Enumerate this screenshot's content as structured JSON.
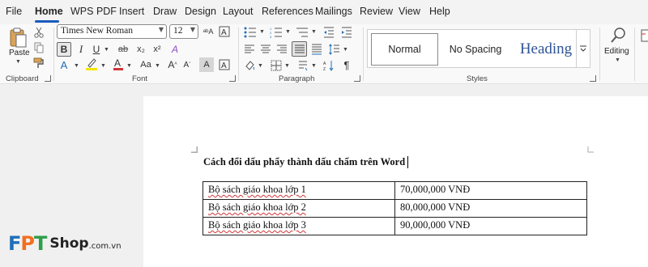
{
  "menu": {
    "tabs": [
      "File",
      "Home",
      "WPS PDF",
      "Insert",
      "Draw",
      "Design",
      "Layout",
      "References",
      "Mailings",
      "Review",
      "View",
      "Help"
    ],
    "active": "Home"
  },
  "ribbon": {
    "clipboard": {
      "paste_label": "Paste",
      "group_label": "Clipboard"
    },
    "font": {
      "font_name": "Times New Roman",
      "font_size": "12",
      "group_label": "Font",
      "accent_colors": {
        "highlight": "#f5e400",
        "font_color": "#d13438"
      }
    },
    "paragraph": {
      "group_label": "Paragraph"
    },
    "styles": {
      "items": [
        "Normal",
        "No Spacing",
        "Heading"
      ],
      "group_label": "Styles"
    },
    "editing": {
      "label": "Editing"
    }
  },
  "document": {
    "heading": "Cách đổi dấu phẩy thành dấu chấm trên Word",
    "table": {
      "rows": [
        [
          "Bộ sách giáo khoa lớp 1",
          "70,000,000 VNĐ"
        ],
        [
          "Bộ sách giáo khoa lớp 2",
          "80,000,000 VNĐ"
        ],
        [
          "Bộ sách giáo khoa lớp 3",
          "90,000,000 VNĐ"
        ]
      ]
    }
  },
  "watermark": {
    "brand": "FPT",
    "shop": "Shop",
    "domain": ".com.vn",
    "colors": {
      "f": "#1e6fb8",
      "p": "#f26f21",
      "t": "#2e9e4a"
    }
  }
}
